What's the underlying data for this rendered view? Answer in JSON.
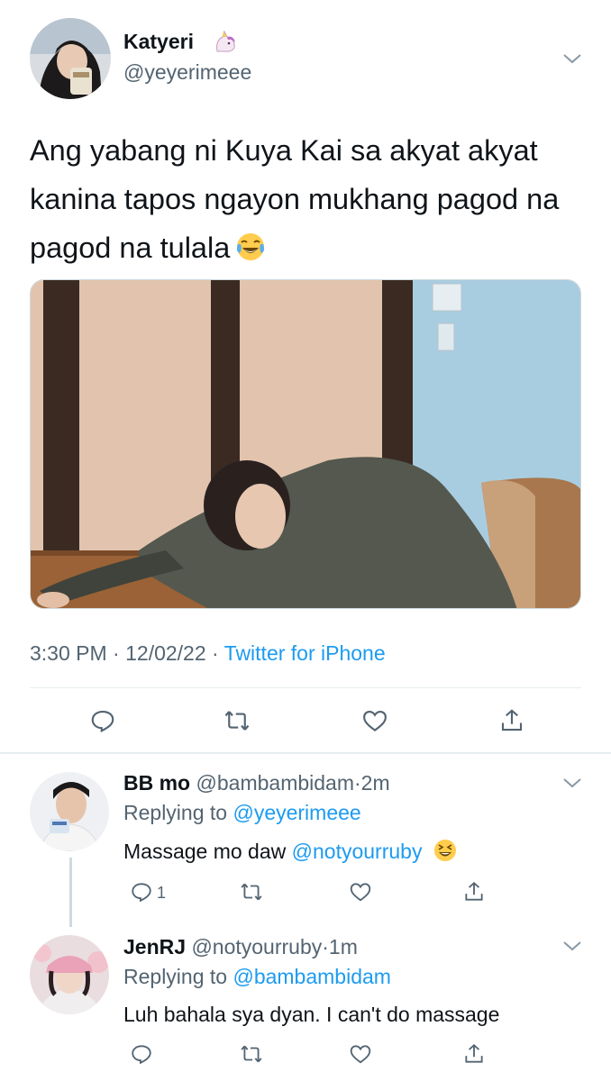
{
  "tweet": {
    "display_name": "Katyeri",
    "name_emoji": "unicorn-emoji",
    "handle": "@yeyerimeee",
    "text": "Ang yabang ni Kuya Kai sa akyat akyat kanina tapos ngayon mukhang pagod na pagod na tulala",
    "text_emoji": "face-with-tears-of-joy",
    "time": "3:30 PM",
    "dot1": " · ",
    "date": "12/02/22",
    "dot2": " · ",
    "source": "Twitter for iPhone"
  },
  "actions": [
    "reply-icon",
    "retweet-icon",
    "like-icon",
    "share-icon"
  ],
  "replies": [
    {
      "display_name": "BB mo",
      "handle": "@bambambidam",
      "dot": "·",
      "age": "2m",
      "replying_prefix": "Replying to",
      "replying_to": "@yeyerimeee",
      "text_plain": "Massage mo daw ",
      "text_mention": "@notyourruby",
      "text_emoji": "grinning-squinting-face",
      "reply_count": "1"
    },
    {
      "display_name": "JenRJ",
      "handle": "@notyourruby",
      "dot": "·",
      "age": "1m",
      "replying_prefix": "Replying to",
      "replying_to": "@bambambidam",
      "text_plain": "Luh bahala sya dyan. I can't do massage"
    }
  ],
  "colors": {
    "link": "#1d9bf0",
    "muted": "#536471",
    "text": "#0f1419",
    "divider": "#e6ecf0"
  }
}
